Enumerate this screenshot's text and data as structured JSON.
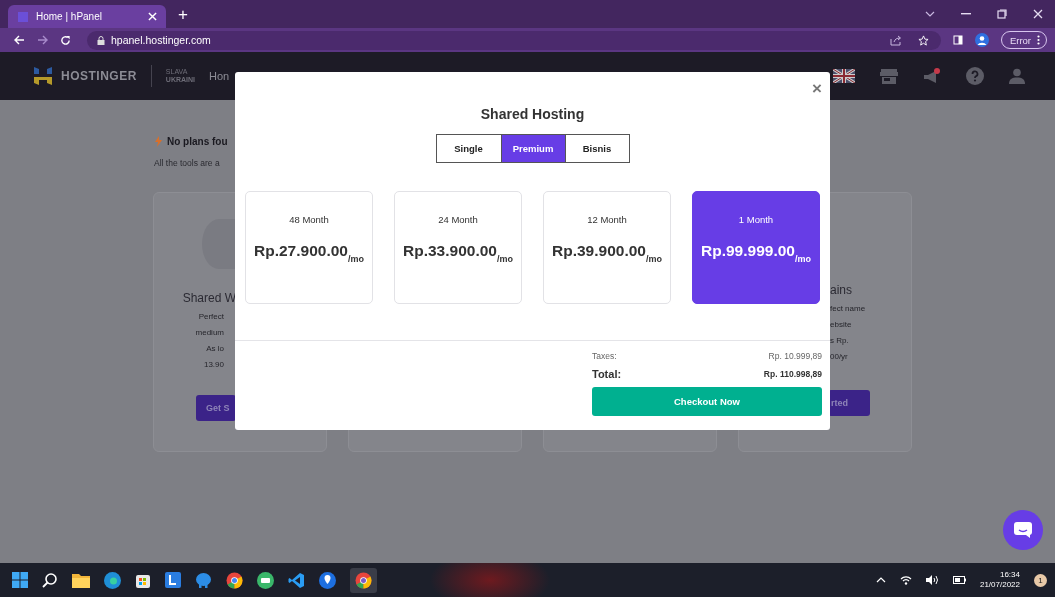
{
  "browser": {
    "tab_title": "Home | hPanel",
    "new_tab": "+",
    "url": "hpanel.hostinger.com",
    "error_button": "Error"
  },
  "header": {
    "brand": "HOSTINGER",
    "tagline_top": "SLAVA",
    "tagline_bottom": "UKRAINI",
    "nav_partial": "Hon"
  },
  "background": {
    "notice_title": "No plans fou",
    "notice_text": "All the tools are a",
    "left_card": {
      "title": "Shared W",
      "lines": [
        "Perfect",
        "medium",
        "As lo",
        "13.90"
      ],
      "button": "Get S"
    },
    "right_card": {
      "title": "ains",
      "lines": [
        "fect name",
        "ebsite",
        "s Rp.",
        "00/yr"
      ],
      "button": "rted"
    }
  },
  "modal": {
    "close": "×",
    "title": "Shared Hosting",
    "plan_tabs": [
      {
        "label": "Single",
        "selected": false
      },
      {
        "label": "Premium",
        "selected": true
      },
      {
        "label": "Bisnis",
        "selected": false
      }
    ],
    "plans": [
      {
        "period": "48 Month",
        "price": "Rp.27.900.00",
        "unit": "/mo",
        "selected": false
      },
      {
        "period": "24 Month",
        "price": "Rp.33.900.00",
        "unit": "/mo",
        "selected": false
      },
      {
        "period": "12 Month",
        "price": "Rp.39.900.00",
        "unit": "/mo",
        "selected": false
      },
      {
        "period": "1 Month",
        "price": "Rp.99.999.00",
        "unit": "/mo",
        "selected": true
      }
    ],
    "taxes_label": "Taxes:",
    "taxes_value": "Rp. 10.999,89",
    "total_label": "Total:",
    "total_value": "Rp. 110.998,89",
    "checkout": "Checkout Now"
  },
  "taskbar": {
    "time": "16:34",
    "date": "21/07/2022",
    "notification_count": "1"
  }
}
